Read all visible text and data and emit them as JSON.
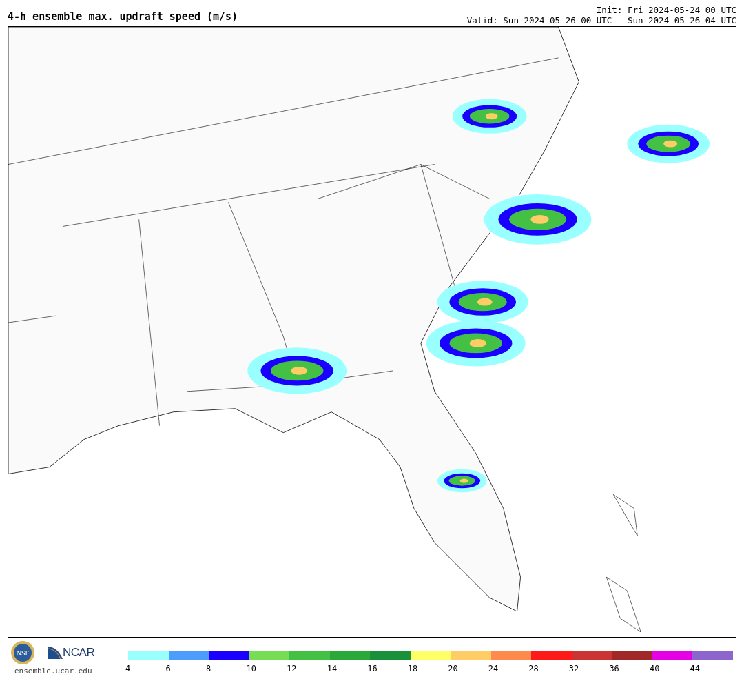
{
  "title": "4-h ensemble max. updraft speed (m/s)",
  "init": "Init: Fri 2024-05-24 00 UTC",
  "valid": "Valid: Sun 2024-05-26 00 UTC - Sun 2024-05-26 04 UTC",
  "logos": {
    "nsf": "NSF",
    "ncar": "NCAR",
    "site": "ensemble.ucar.edu"
  },
  "legend": [
    {
      "color": "#99ffff",
      "label": "4"
    },
    {
      "color": "#4d9dff",
      "label": "6"
    },
    {
      "color": "#1a00ff",
      "label": "8"
    },
    {
      "color": "#77dd55",
      "label": "10"
    },
    {
      "color": "#44c144",
      "label": "12"
    },
    {
      "color": "#2aa83a",
      "label": "14"
    },
    {
      "color": "#19913a",
      "label": "16"
    },
    {
      "color": "#ffff66",
      "label": "18"
    },
    {
      "color": "#ffcc66",
      "label": "20"
    },
    {
      "color": "#ff8a4d",
      "label": "24"
    },
    {
      "color": "#ff1a1a",
      "label": "28"
    },
    {
      "color": "#cc3333",
      "label": "32"
    },
    {
      "color": "#a02828",
      "label": "36"
    },
    {
      "color": "#e600e6",
      "label": "40"
    },
    {
      "color": "#8c66cc",
      "label": "44"
    }
  ]
}
